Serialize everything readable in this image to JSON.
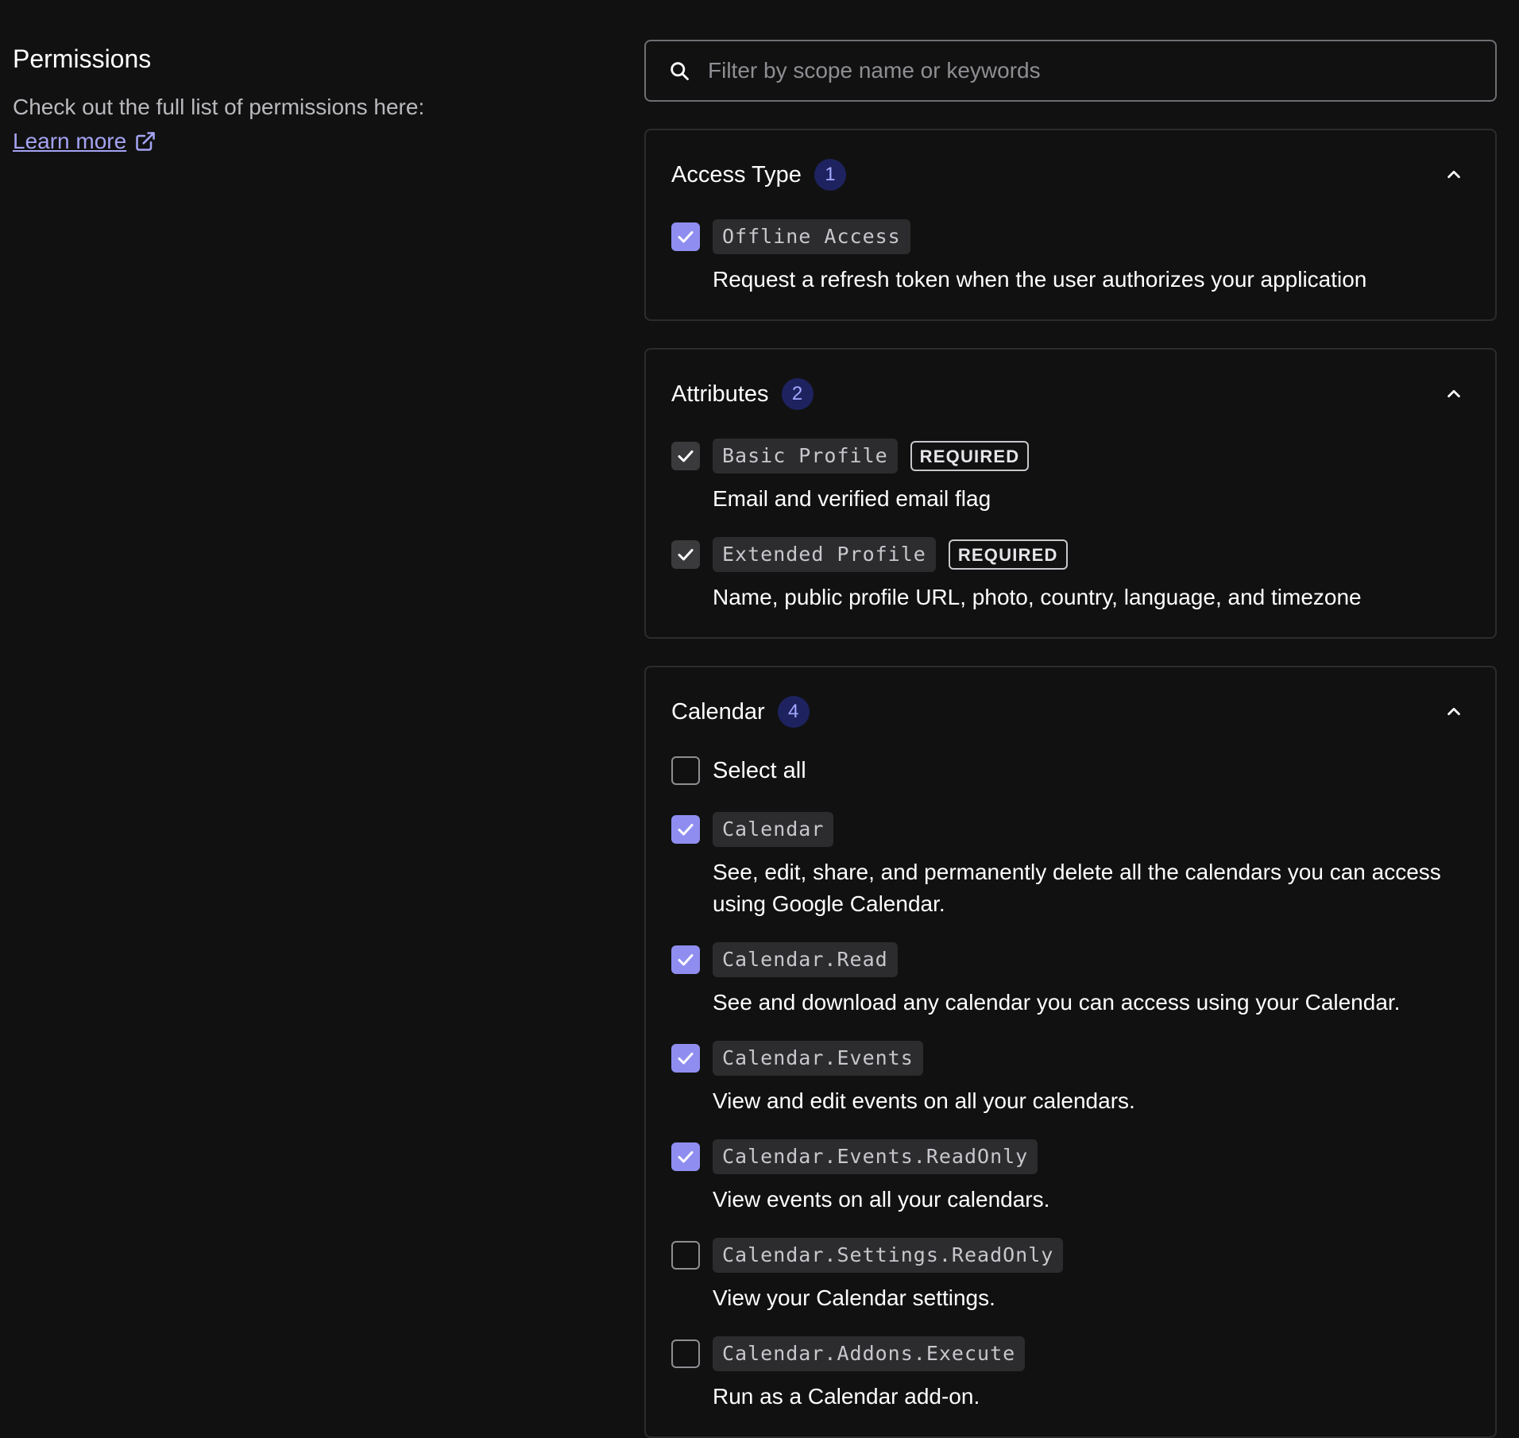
{
  "sidebar": {
    "title": "Permissions",
    "description": "Check out the full list of permissions here:",
    "learn_more": "Learn more"
  },
  "search": {
    "placeholder": "Filter by scope name or keywords",
    "value": ""
  },
  "sections": [
    {
      "title": "Access Type",
      "count": "1",
      "items": [
        {
          "code": "Offline Access",
          "state": "checked",
          "required": false,
          "description": "Request a refresh token when the user authorizes your application"
        }
      ]
    },
    {
      "title": "Attributes",
      "count": "2",
      "required_label": "REQUIRED",
      "items": [
        {
          "code": "Basic Profile",
          "state": "locked",
          "required": true,
          "description": "Email and verified email flag"
        },
        {
          "code": "Extended Profile",
          "state": "locked",
          "required": true,
          "description": "Name, public profile URL, photo, country, language, and timezone"
        }
      ]
    },
    {
      "title": "Calendar",
      "count": "4",
      "select_all_label": "Select all",
      "select_all_state": "unchecked",
      "items": [
        {
          "code": "Calendar",
          "state": "checked",
          "required": false,
          "description": "See, edit, share, and permanently delete all the calendars you can access using Google Calendar."
        },
        {
          "code": "Calendar.Read",
          "state": "checked",
          "required": false,
          "description": "See and download any calendar you can access using your Calendar."
        },
        {
          "code": "Calendar.Events",
          "state": "checked",
          "required": false,
          "description": "View and edit events on all your calendars."
        },
        {
          "code": "Calendar.Events.ReadOnly",
          "state": "checked",
          "required": false,
          "description": "View events on all your calendars."
        },
        {
          "code": "Calendar.Settings.ReadOnly",
          "state": "unchecked",
          "required": false,
          "description": "View your Calendar settings."
        },
        {
          "code": "Calendar.Addons.Execute",
          "state": "unchecked",
          "required": false,
          "description": "Run as a Calendar add-on."
        }
      ]
    }
  ],
  "icons": {
    "search": "search-icon",
    "external_link": "external-link-icon",
    "chevron": "chevron-up-icon",
    "check": "check-icon"
  },
  "colors": {
    "background": "#111111",
    "accent_checkbox": "#8f8ef0",
    "link": "#a4a3f2",
    "badge_bg": "#1e2360",
    "badge_text": "#a4a8ff",
    "card_border": "#2c2c2e"
  }
}
